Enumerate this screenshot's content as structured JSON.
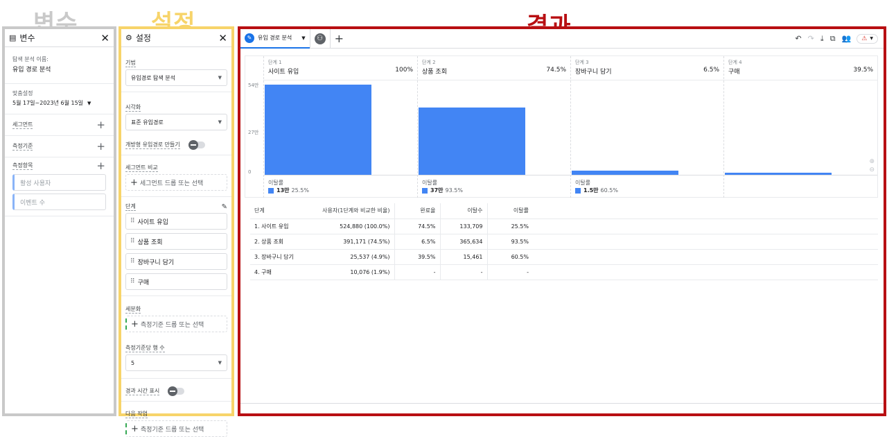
{
  "annotations": {
    "vars_title": "변수",
    "vars_color": "#c9c9c9",
    "settings_title": "설정",
    "settings_color": "#f7d46a",
    "results_title": "결과",
    "results_color": "#b80f12"
  },
  "vars_panel": {
    "title": "변수",
    "analysis_name_label": "탐색 분석 이름:",
    "analysis_name": "유입 경로 분석",
    "custom_label": "맞춤설정",
    "date_range": "5월 17일~2023년 6월 15일",
    "segments_label": "세그먼트",
    "dimensions_label": "측정기준",
    "metrics_label": "측정항목",
    "metric_chips": [
      "활성 사용자",
      "이벤트 수"
    ]
  },
  "settings_panel": {
    "title": "설정",
    "technique_label": "기법",
    "technique_value": "유입경로 탐색 분석",
    "viz_label": "시각화",
    "viz_value": "표준 유입경로",
    "open_funnel_label": "개방형 유입경로 만들기",
    "segment_compare_label": "세그먼트 비교",
    "segment_drop": "세그먼트 드롭 또는 선택",
    "steps_label": "단계",
    "steps": [
      "사이트 유입",
      "상품 조회",
      "장바구니 담기",
      "구매"
    ],
    "breakdown_label": "세분화",
    "dimension_drop": "측정기준 드롭 또는 선택",
    "rows_per_dim_label": "측정기준당 행 수",
    "rows_per_dim_value": "5",
    "elapsed_label": "경과 시간 표시",
    "next_action_label": "다음 작업",
    "next_drop": "측정기준 드롭 또는 선택"
  },
  "results_panel": {
    "tab_name": "유입 경로 분석",
    "y_ticks": [
      "54만",
      "27만",
      "0"
    ],
    "drop_label": "이탈률"
  },
  "chart_data": {
    "type": "bar",
    "categories": [
      "사이트 유입",
      "상품 조회",
      "장바구니 담기",
      "구매"
    ],
    "stage_labels": [
      "단계 1",
      "단계 2",
      "단계 3",
      "단계 4"
    ],
    "values": [
      524880,
      391171,
      25537,
      10076
    ],
    "completion_pct": [
      "100%",
      "74.5%",
      "6.5%",
      "39.5%"
    ],
    "drop_counts": [
      "13만",
      "37만",
      "1.5만",
      ""
    ],
    "drop_rates": [
      "25.5%",
      "93.5%",
      "60.5%",
      ""
    ],
    "ylim": [
      0,
      540000
    ],
    "y_ticks": [
      540000,
      270000,
      0
    ],
    "bar_color": "#4285f4"
  },
  "table": {
    "headers": [
      "단계",
      "사용자(1단계와 비교한 비율)",
      "완료율",
      "이탈수",
      "이탈률"
    ],
    "rows": [
      [
        "1. 사이트 유입",
        "524,880 (100.0%)",
        "74.5%",
        "133,709",
        "25.5%"
      ],
      [
        "2. 상품 조회",
        "391,171 (74.5%)",
        "6.5%",
        "365,634",
        "93.5%"
      ],
      [
        "3. 장바구니 담기",
        "25,537 (4.9%)",
        "39.5%",
        "15,461",
        "60.5%"
      ],
      [
        "4. 구매",
        "10,076 (1.9%)",
        "-",
        "-",
        "-"
      ]
    ]
  }
}
